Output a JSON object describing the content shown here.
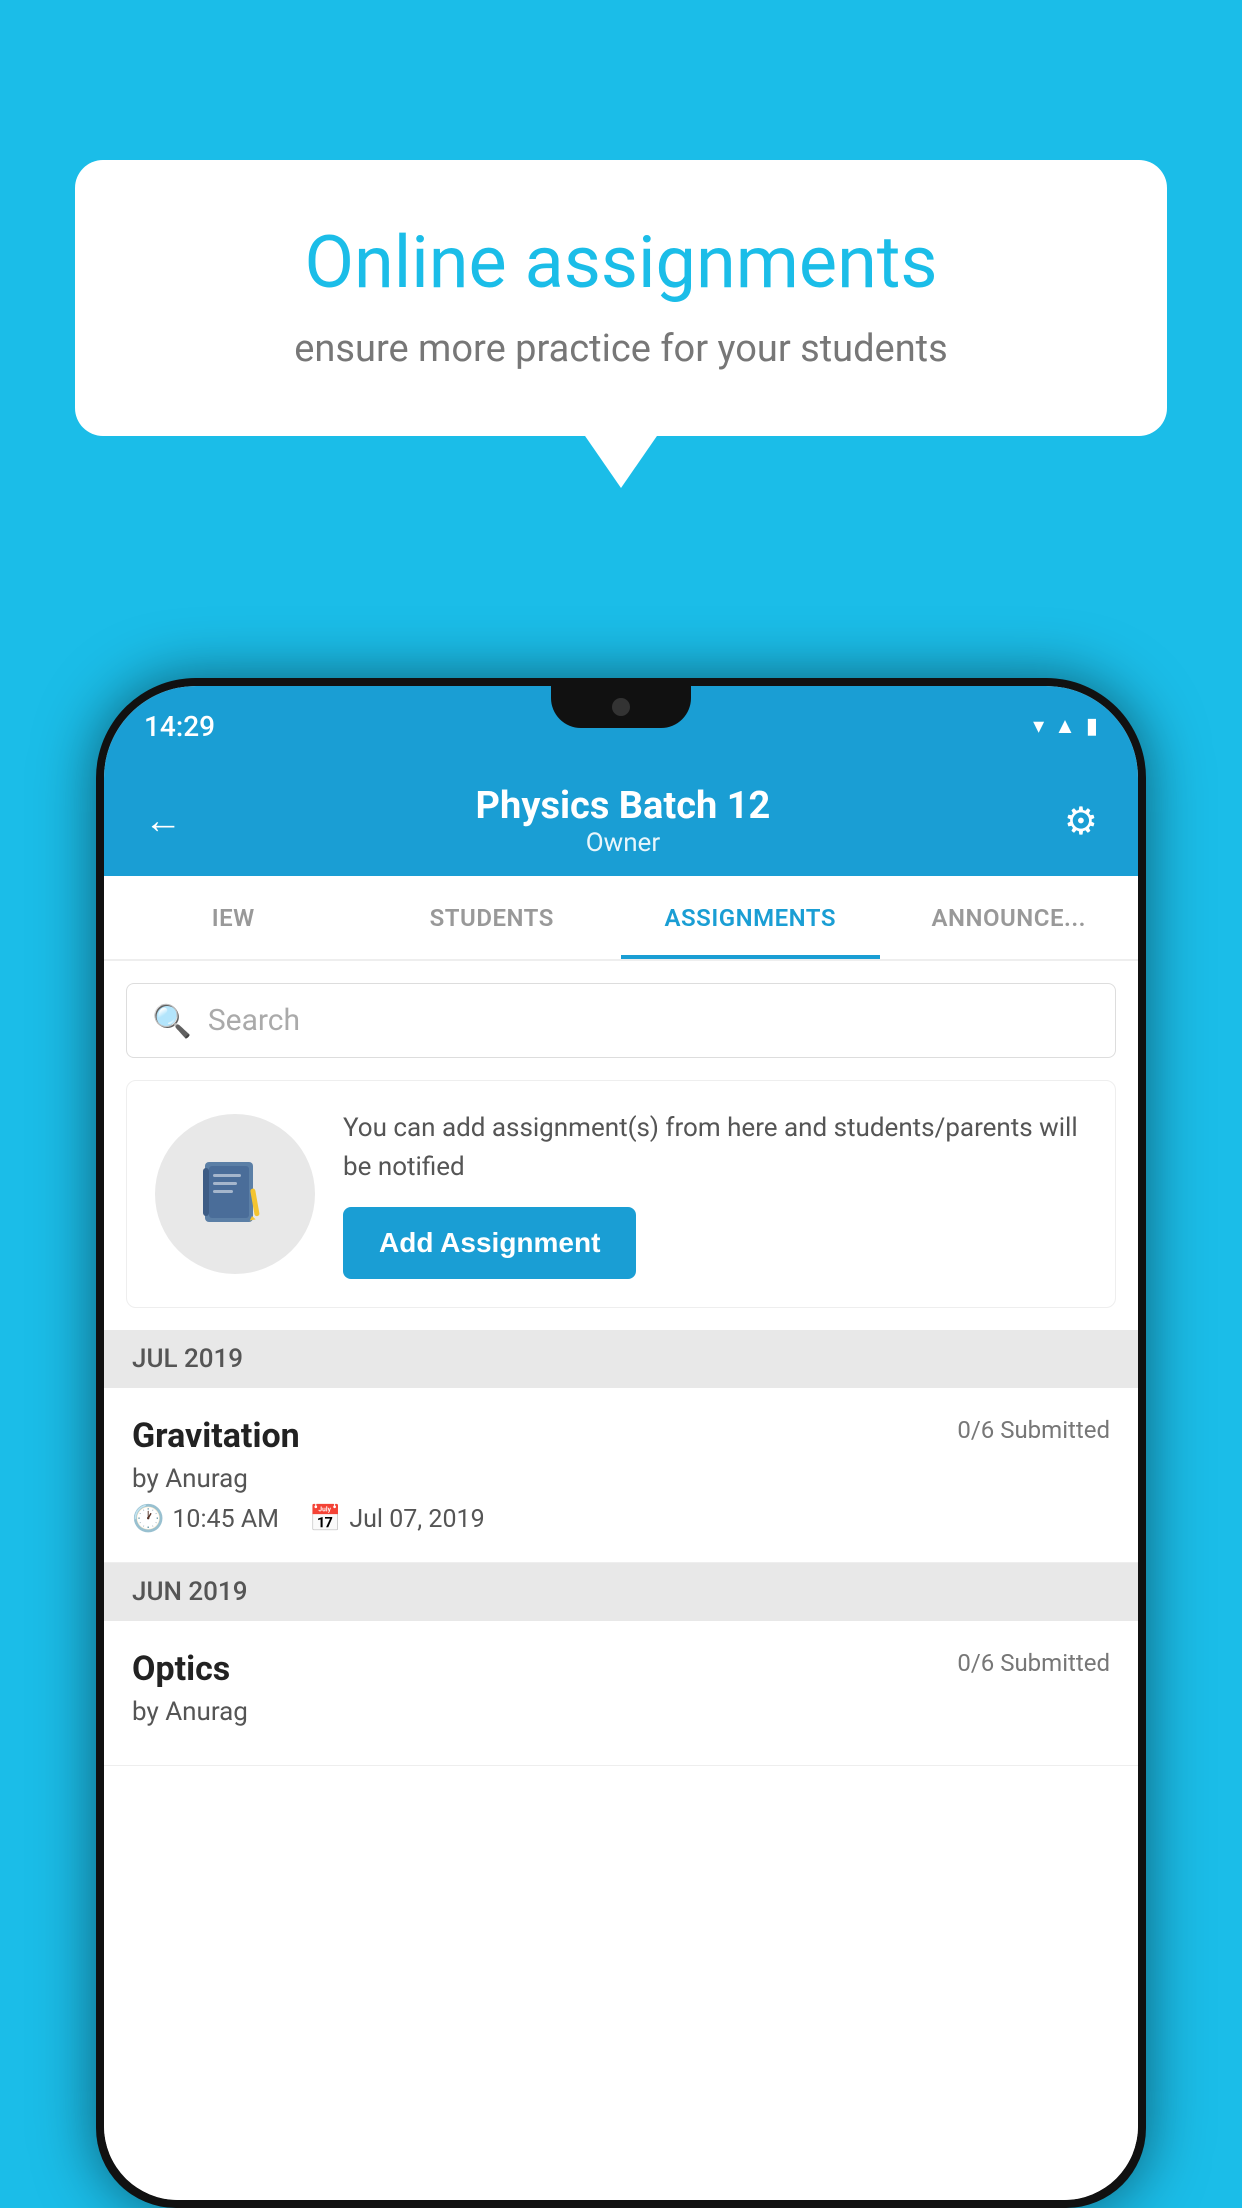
{
  "background_color": "#1BBDE8",
  "speech_bubble": {
    "title": "Online assignments",
    "subtitle": "ensure more practice for your students"
  },
  "phone": {
    "status_bar": {
      "time": "14:29",
      "icons": [
        "wifi",
        "signal",
        "battery"
      ]
    },
    "app_header": {
      "title": "Physics Batch 12",
      "subtitle": "Owner",
      "back_label": "←",
      "settings_label": "⚙"
    },
    "tabs": [
      {
        "label": "IEW",
        "active": false
      },
      {
        "label": "STUDENTS",
        "active": false
      },
      {
        "label": "ASSIGNMENTS",
        "active": true
      },
      {
        "label": "ANNOUNCEMENTS",
        "active": false
      }
    ],
    "search": {
      "placeholder": "Search"
    },
    "info_card": {
      "description": "You can add assignment(s) from here and students/parents will be notified",
      "button_label": "Add Assignment"
    },
    "sections": [
      {
        "header": "JUL 2019",
        "assignments": [
          {
            "title": "Gravitation",
            "submitted": "0/6 Submitted",
            "by": "by Anurag",
            "time": "10:45 AM",
            "date": "Jul 07, 2019"
          }
        ]
      },
      {
        "header": "JUN 2019",
        "assignments": [
          {
            "title": "Optics",
            "submitted": "0/6 Submitted",
            "by": "by Anurag",
            "time": "",
            "date": ""
          }
        ]
      }
    ]
  }
}
